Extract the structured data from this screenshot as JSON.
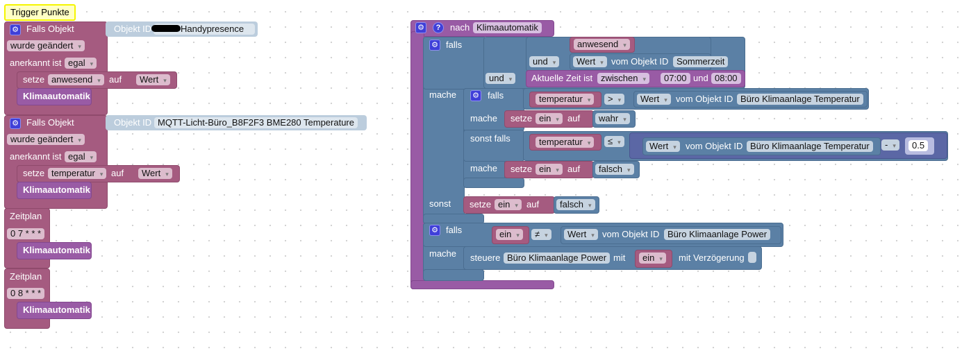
{
  "comment": {
    "text": "Trigger Punkte"
  },
  "triggers": [
    {
      "header": "Falls Objekt",
      "id_label": "Objekt ID",
      "id_value": "Handypresence",
      "mode": "wurde geändert",
      "ack_label": "anerkannt ist",
      "ack": "egal",
      "set_label": "setze",
      "var": "anwesend",
      "to_label": "auf",
      "value": "Wert",
      "call": "Klimaautomatik"
    },
    {
      "header": "Falls Objekt",
      "id_label": "Objekt ID",
      "id_value": "MQTT-Licht-Büro_B8F2F3 BME280  Temperature",
      "mode": "wurde geändert",
      "ack_label": "anerkannt ist",
      "ack": "egal",
      "set_label": "setze",
      "var": "temperatur",
      "to_label": "auf",
      "value": "Wert",
      "call": "Klimaautomatik"
    }
  ],
  "schedules": [
    {
      "label": "Zeitplan",
      "cron": "0 7 * * *",
      "call": "Klimaautomatik"
    },
    {
      "label": "Zeitplan",
      "cron": "0 8 * * *",
      "call": "Klimaautomatik"
    }
  ],
  "procedure": {
    "label": "nach",
    "name": "Klimaautomatik",
    "if1": {
      "falls": "falls",
      "mache": "mache",
      "sonst": "sonst",
      "and_outer": "und",
      "and_inner": "und",
      "var": "anwesend",
      "wert": "Wert",
      "vom": "vom Objekt ID",
      "obj": "Sommerzeit",
      "time_label": "Aktuelle Zeit ist",
      "time_mode": "zwischen",
      "t1": "07:00",
      "t_und": "und",
      "t2": "08:00"
    },
    "inner": {
      "falls": "falls",
      "mache": "mache",
      "sonst_falls": "sonst falls",
      "mache2": "mache",
      "c1": {
        "var": "temperatur",
        "op": ">",
        "wert": "Wert",
        "vom": "vom Objekt ID",
        "obj": "Büro Klimaanlage Temperatur"
      },
      "s1": {
        "setze": "setze",
        "var": "ein",
        "auf": "auf",
        "val": "wahr"
      },
      "c2": {
        "var": "temperatur",
        "op": "≤",
        "wert": "Wert",
        "vom": "vom Objekt ID",
        "obj": "Büro Klimaanlage Temperatur",
        "mop": "-",
        "num": "0.5"
      },
      "s2": {
        "setze": "setze",
        "var": "ein",
        "auf": "auf",
        "val": "falsch"
      }
    },
    "else": {
      "setze": "setze",
      "var": "ein",
      "auf": "auf",
      "val": "falsch"
    },
    "if2": {
      "falls": "falls",
      "mache": "mache",
      "var": "ein",
      "op": "≠",
      "wert": "Wert",
      "vom": "vom Objekt ID",
      "obj": "Büro Klimaanlage Power",
      "steuere": "steuere",
      "target": "Büro Klimaanlage Power",
      "mit": "mit",
      "val": "ein",
      "delay": "mit Verzögerung",
      "delay_checked": false
    }
  },
  "colors": {
    "trigger": "#a55b80",
    "procedure": "#995ba5",
    "logic": "#5b80a5",
    "math": "#5b67a5",
    "comment": "#ffff00"
  }
}
